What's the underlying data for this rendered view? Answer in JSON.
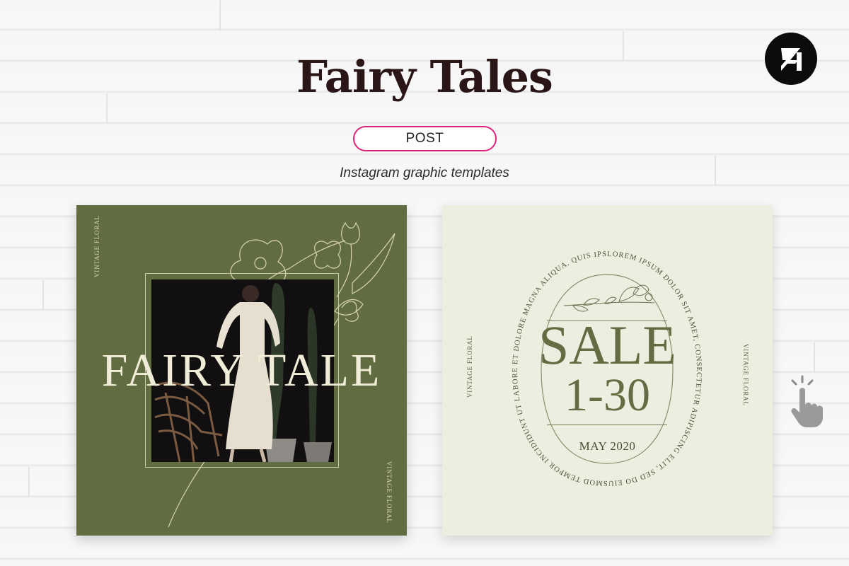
{
  "header": {
    "title": "Fairy Tales",
    "badge": "POST",
    "subtitle": "Instagram graphic templates"
  },
  "brand": {
    "icon": "brand-logo-icon",
    "color": "#0c0c0c"
  },
  "card_left": {
    "headline": "FAIRY TALE",
    "label_top": "VINTAGE FLORAL",
    "label_bottom": "VINTAGE FLORAL",
    "background": "#626c41"
  },
  "card_right": {
    "sale": "SALE",
    "dates": "1-30",
    "month": "MAY 2020",
    "label_left": "VINTAGE FLORAL",
    "label_right": "VINTAGE FLORAL",
    "ring_text": "LOREM IPSUM DOLOR SIT AMET, CONSECTETUR ADIPISCING ELIT, SED DO EIUSMOD TEMPOR INCIDIDUNT UT LABORE ET DOLORE MAGNA ALIQUA. QUIS IPSUM",
    "background": "#eeeee0"
  },
  "colors": {
    "accent": "#e0217a",
    "olive": "#646c43"
  },
  "icons": {
    "pointer": "hand-pointer-icon"
  }
}
